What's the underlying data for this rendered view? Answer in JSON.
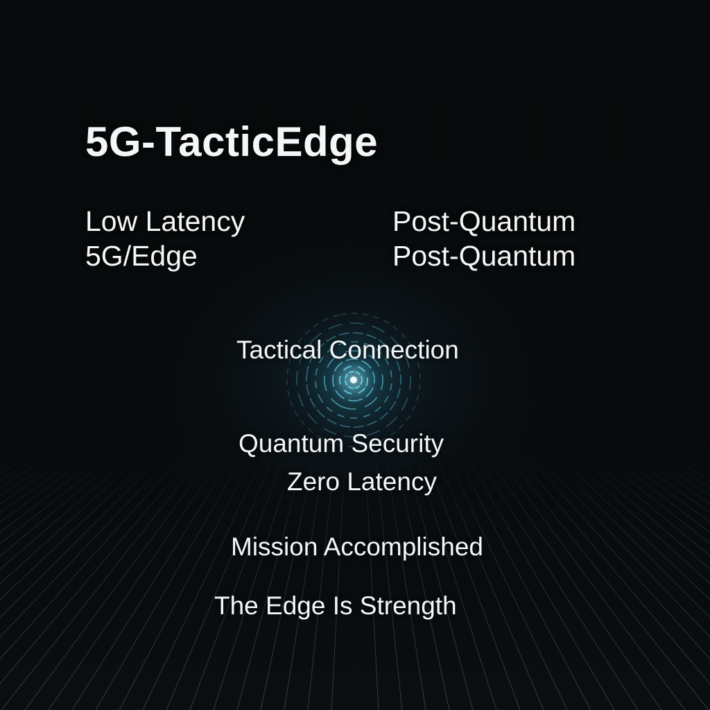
{
  "title": "5G-TacticEdge",
  "features": {
    "left": [
      "Low Latency",
      "5G/Edge"
    ],
    "right": [
      "Post-Quantum",
      "Post-Quantum"
    ]
  },
  "center_lines": {
    "connection": "Tactical Connection",
    "security": "Quantum Security",
    "latency": "Zero Latency",
    "mission": "Mission Accomplished",
    "tagline": "The Edge Is Strength"
  },
  "colors": {
    "background": "#060809",
    "text": "#f4f6f7",
    "glow": "#5fd6f0",
    "grid": "#2a3a44"
  },
  "icons": [
    "concentric-signal-icon"
  ]
}
